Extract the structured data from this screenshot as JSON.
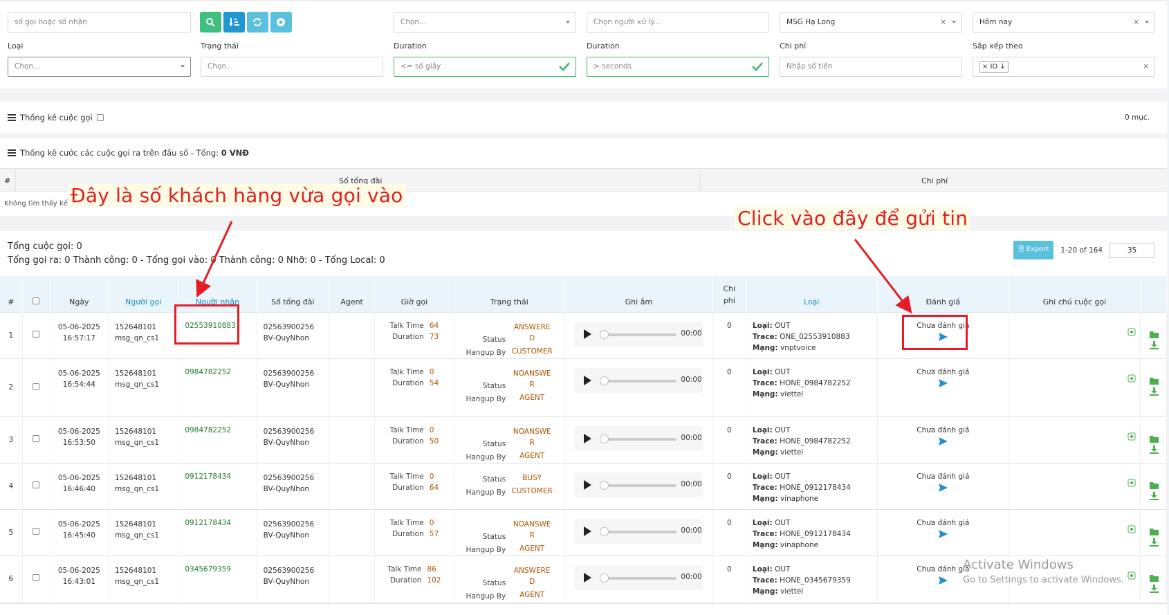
{
  "filters": {
    "search_placeholder": "số gọi hoặc số nhận",
    "select1_placeholder": "Chọn...",
    "handler_placeholder": "Chọn người xử lý...",
    "branch_value": "MSG Hạ Long",
    "date_value": "Hôm nay",
    "type_label": "Loại",
    "type_placeholder": "Chọn...",
    "status_label": "Trạng thái",
    "status_placeholder": "Chọn...",
    "duration1_label": "Duration",
    "duration1_placeholder": "<= số giây",
    "duration2_label": "Duration",
    "duration2_placeholder": "> seconds",
    "cost_label": "Chi phí",
    "cost_placeholder": "Nhập số tiền",
    "sort_label": "Sắp xếp theo",
    "sort_tag": "× ID ↓"
  },
  "stats": {
    "title": "Thống kê cuộc gọi",
    "count_text": "0 mục."
  },
  "cost_stats": {
    "title": "Thống kê cước các cuộc gọi ra trên đầu số - Tổng: ",
    "total": "0 VNĐ",
    "col_hash": "#",
    "col_switch": "Số tổng đài",
    "col_cost": "Chi phí",
    "empty": "Không tìm thấy kết quả nào."
  },
  "summary": {
    "line1": "Tổng cuộc gọi: 0",
    "line2": "Tổng gọi ra: 0 Thành công: 0 - Tổng gọi vào: 0 Thành công: 0 Nhỡ: 0 - Tổng Local: 0"
  },
  "pager": {
    "export": "Export",
    "range": "1-20 of 164",
    "per_page": "35"
  },
  "columns": {
    "hash": "#",
    "date": "Ngày",
    "caller": "Người gọi",
    "receiver": "Người nhận",
    "switch": "Số tổng đài",
    "agent": "Agent",
    "time": "Giờ gọi",
    "status": "Trạng thái",
    "record": "Ghi âm",
    "cost1": "Chi",
    "cost2": "phí",
    "type": "Loại",
    "rate": "Đánh giá",
    "note": "Ghi chú cuộc gọi"
  },
  "labels": {
    "talk": "Talk Time",
    "duration": "Duration",
    "status": "Status",
    "hangup": "Hangup By",
    "loai": "Loại:",
    "trace": "Trace:",
    "mang": "Mạng:",
    "unrated": "Chưa đánh giá",
    "ptime": "00:00"
  },
  "rows": [
    {
      "n": "1",
      "date": "05-06-2025",
      "time": "16:57:17",
      "caller": "152648101",
      "caller2": "msg_qn_cs1",
      "receiver": "02553910883",
      "sw": "02563900256",
      "sw2": "BV-QuyNhon",
      "talk": "64",
      "dur": "73",
      "status_order": "sh",
      "status": "ANSWERED",
      "hangup": "CUSTOMER",
      "cost": "0",
      "loai": "OUT",
      "trace": "ONE_02553910883",
      "mang": "vnptvoice"
    },
    {
      "n": "2",
      "date": "05-06-2025",
      "time": "16:54:44",
      "caller": "152648101",
      "caller2": "msg_qn_cs1",
      "receiver": "0984782252",
      "sw": "02563900256",
      "sw2": "BV-QuyNhon",
      "talk": "0",
      "dur": "54",
      "status_order": "sh",
      "status": "NOANSWER",
      "hangup": "AGENT",
      "cost": "0",
      "loai": "OUT",
      "trace": "HONE_0984782252",
      "mang": "viettel"
    },
    {
      "n": "3",
      "date": "05-06-2025",
      "time": "16:53:50",
      "caller": "152648101",
      "caller2": "msg_qn_cs1",
      "receiver": "0984782252",
      "sw": "02563900256",
      "sw2": "BV-QuyNhon",
      "talk": "0",
      "dur": "50",
      "status_order": "sh",
      "status": "NOANSWER",
      "hangup": "AGENT",
      "cost": "0",
      "loai": "OUT",
      "trace": "HONE_0984782252",
      "mang": "viettel"
    },
    {
      "n": "4",
      "date": "05-06-2025",
      "time": "16:46:40",
      "caller": "152648101",
      "caller2": "msg_qn_cs1",
      "receiver": "0912178434",
      "sw": "02563900256",
      "sw2": "BV-QuyNhon",
      "talk": "0",
      "dur": "64",
      "status_order": "sh",
      "status": "BUSY",
      "hangup": "CUSTOMER",
      "cost": "0",
      "loai": "OUT",
      "trace": "HONE_0912178434",
      "mang": "vinaphone"
    },
    {
      "n": "5",
      "date": "05-06-2025",
      "time": "16:45:40",
      "caller": "152648101",
      "caller2": "msg_qn_cs1",
      "receiver": "0912178434",
      "sw": "02563900256",
      "sw2": "BV-QuyNhon",
      "talk": "0",
      "dur": "57",
      "status_order": "sh",
      "status": "NOANSWER",
      "hangup": "AGENT",
      "cost": "0",
      "loai": "OUT",
      "trace": "HONE_0912178434",
      "mang": "vinaphone"
    },
    {
      "n": "6",
      "date": "05-06-2025",
      "time": "16:43:01",
      "caller": "152648101",
      "caller2": "msg_qn_cs1",
      "receiver": "0345679359",
      "sw": "02563900256",
      "sw2": "BV-QuyNhon",
      "talk": "86",
      "dur": "102",
      "status_order": "sh",
      "status": "ANSWERED",
      "hangup": "AGENT",
      "cost": "0",
      "loai": "OUT",
      "trace": "HONE_0345679359",
      "mang": "viettel"
    }
  ],
  "annotations": {
    "left": "Đây là số khách hàng vừa gọi vào",
    "right": "Click vào đây để gửi tin"
  },
  "watermark": {
    "title": "Activate Windows",
    "sub": "Go to Settings to activate Windows."
  },
  "colors": {
    "accent_blue": "#1a8bc1",
    "green_btn": "#3fbf7f",
    "blue_btn": "#2196d3",
    "light_blue_btn": "#5bc0de",
    "red_annot": "#e51c23",
    "ok_green": "#3fb66a"
  }
}
